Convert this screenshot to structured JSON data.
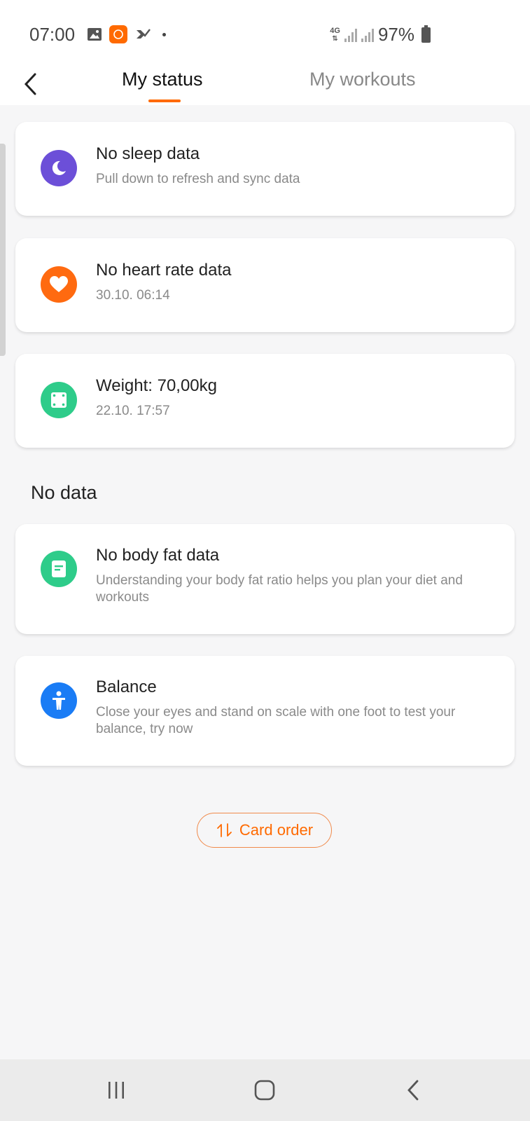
{
  "status_bar": {
    "time": "07:00",
    "network": "4G",
    "battery": "97%",
    "icons": [
      "gallery-icon",
      "app-notification-icon",
      "check-icon"
    ]
  },
  "header": {
    "tabs": [
      {
        "label": "My status",
        "active": true
      },
      {
        "label": "My workouts",
        "active": false
      }
    ],
    "accent_color": "#ff6a00"
  },
  "cards_with_data": [
    {
      "icon": "sleep-icon",
      "icon_color": "#6c4fd8",
      "title": "No sleep data",
      "subtitle": "Pull down to refresh and sync data"
    },
    {
      "icon": "heart-icon",
      "icon_color": "#ff6a10",
      "title": "No heart rate data",
      "subtitle": "30.10. 06:14"
    },
    {
      "icon": "scale-icon",
      "icon_color": "#2ecc8a",
      "title": "Weight: 70,00kg",
      "subtitle": "22.10. 17:57"
    }
  ],
  "no_data_section": {
    "label": "No data",
    "cards": [
      {
        "icon": "body-fat-icon",
        "icon_color": "#2ecc8a",
        "title": "No body fat data",
        "subtitle": "Understanding your body fat ratio helps you plan your diet and workouts"
      },
      {
        "icon": "balance-person-icon",
        "icon_color": "#1a7cf5",
        "title": "Balance",
        "subtitle": "Close your eyes and stand on scale with one foot to test your balance, try now"
      }
    ]
  },
  "card_order_button": {
    "label": "Card order",
    "icon": "sort-arrows-icon"
  },
  "navbar": {
    "icons": [
      "recents-icon",
      "home-icon",
      "back-icon"
    ]
  }
}
